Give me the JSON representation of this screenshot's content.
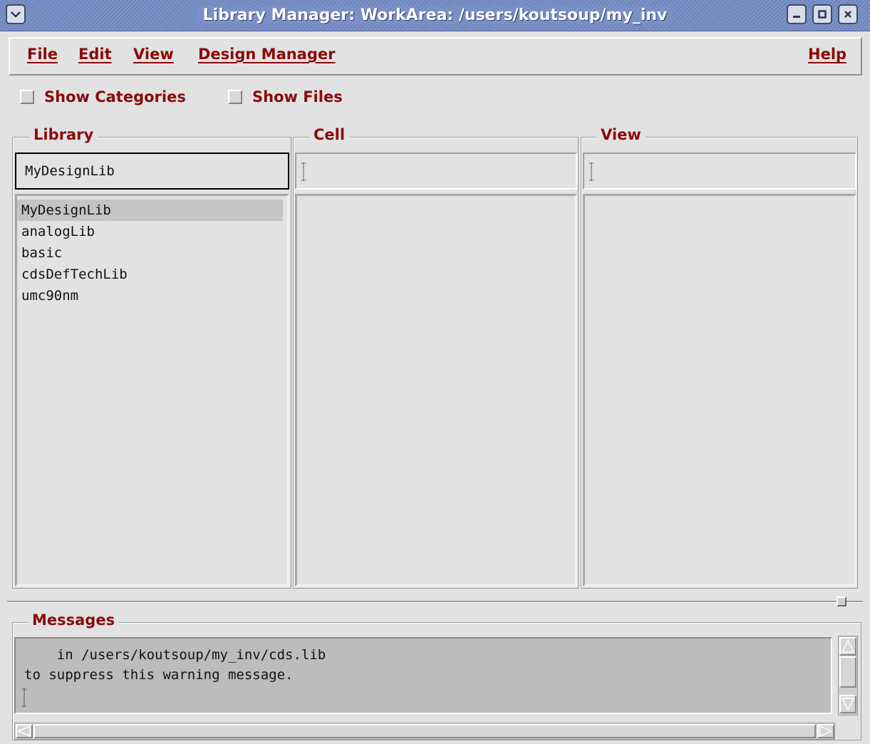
{
  "window": {
    "title": "Library Manager: WorkArea: /users/koutsoup/my_inv"
  },
  "menubar": {
    "file": "File",
    "edit": "Edit",
    "view": "View",
    "design_manager": "Design Manager",
    "help": "Help"
  },
  "options": {
    "show_categories": "Show Categories",
    "show_files": "Show Files"
  },
  "library": {
    "label": "Library",
    "value": "MyDesignLib",
    "items": [
      "MyDesignLib",
      "analogLib",
      "basic",
      "cdsDefTechLib",
      "umc90nm"
    ],
    "selected": "MyDesignLib"
  },
  "cell": {
    "label": "Cell",
    "value": ""
  },
  "view": {
    "label": "View",
    "value": ""
  },
  "messages": {
    "label": "Messages",
    "lines": [
      "    in /users/koutsoup/my_inv/cds.lib",
      "to suppress this warning message."
    ]
  },
  "colors": {
    "label_red": "#8b0a0a",
    "titlebar": "#7a8fc6",
    "background": "#e2e2e2"
  }
}
